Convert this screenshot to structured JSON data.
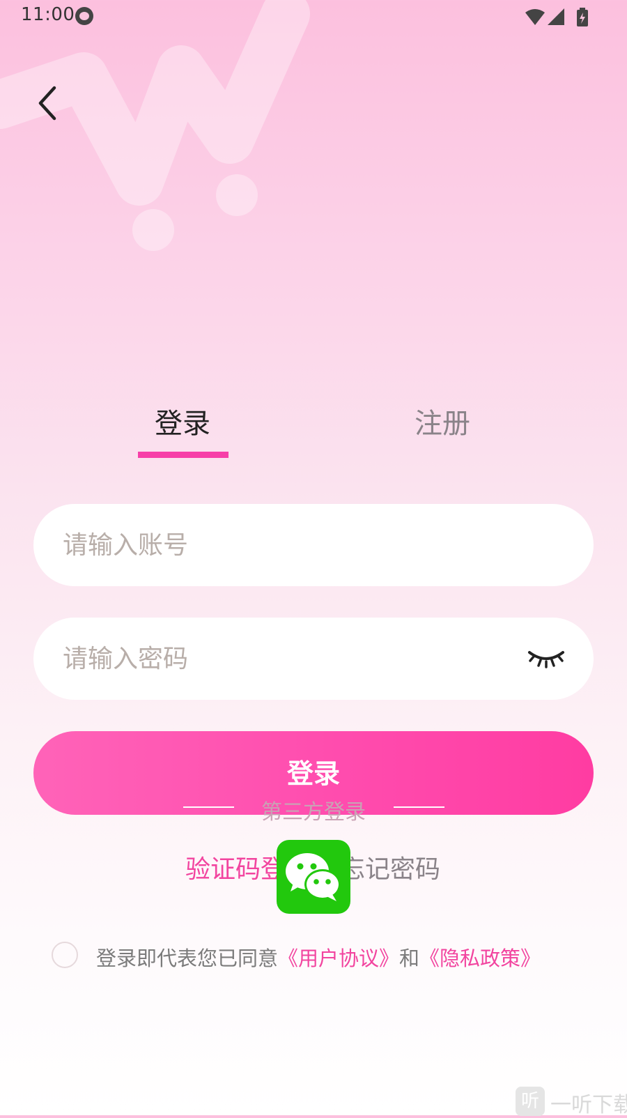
{
  "status_bar": {
    "time": "11:00"
  },
  "tabs": {
    "login": "登录",
    "register": "注册"
  },
  "form": {
    "account_placeholder": "请输入账号",
    "password_placeholder": "请输入密码",
    "login_button": "登录"
  },
  "third_party": {
    "label": "第三方登录",
    "wechat_icon": "wechat-icon"
  },
  "links": {
    "sms_login": "验证码登录",
    "forgot_password": "忘记密码"
  },
  "agreement": {
    "prefix": "登录即代表您已同意",
    "user_agreement": "《用户协议》",
    "and": "和",
    "privacy_policy": "《隐私政策》"
  },
  "watermark": {
    "logo": "听",
    "text": "一听下载"
  },
  "colors": {
    "accent": "#f73fa8",
    "wechat": "#22c80d"
  }
}
